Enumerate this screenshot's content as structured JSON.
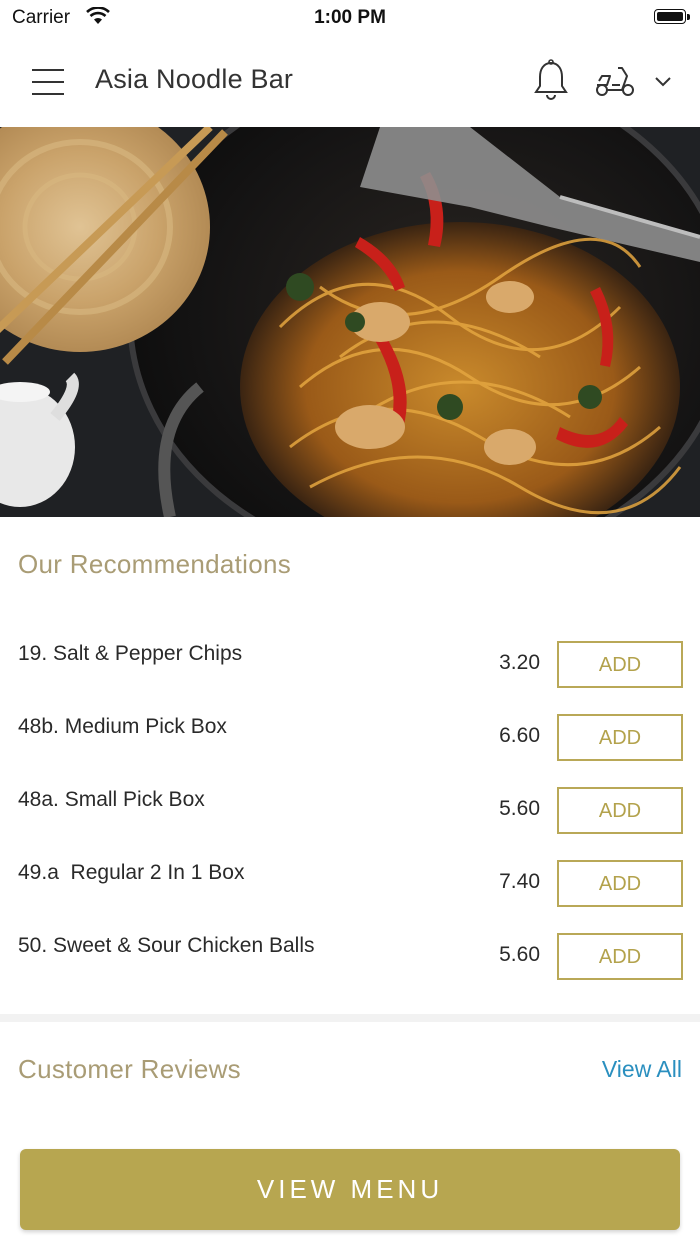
{
  "status_bar": {
    "carrier": "Carrier",
    "time": "1:00 PM"
  },
  "nav": {
    "title": "Asia Noodle Bar",
    "icons": [
      "menu-icon",
      "bell-icon",
      "scooter-icon",
      "chevron-down-icon"
    ]
  },
  "hero": {
    "image": "wok-noodles-photo"
  },
  "recommendations": {
    "title": "Our Recommendations",
    "items": [
      {
        "name": "19. Salt & Pepper Chips",
        "price": "3.20",
        "button": "ADD"
      },
      {
        "name": "48b. Medium Pick Box",
        "price": "6.60",
        "button": "ADD"
      },
      {
        "name": "48a. Small Pick Box",
        "price": "5.60",
        "button": "ADD"
      },
      {
        "name": "49.a  Regular 2 In 1 Box",
        "price": "7.40",
        "button": "ADD"
      },
      {
        "name": "50. Sweet & Sour Chicken Balls",
        "price": "5.60",
        "button": "ADD"
      }
    ]
  },
  "reviews": {
    "title": "Customer Reviews",
    "view_all": "View All"
  },
  "footer": {
    "view_menu": "VIEW MENU"
  },
  "colors": {
    "accent": "#b7a650",
    "section_title": "#a99c75",
    "link": "#2a8fbf"
  }
}
